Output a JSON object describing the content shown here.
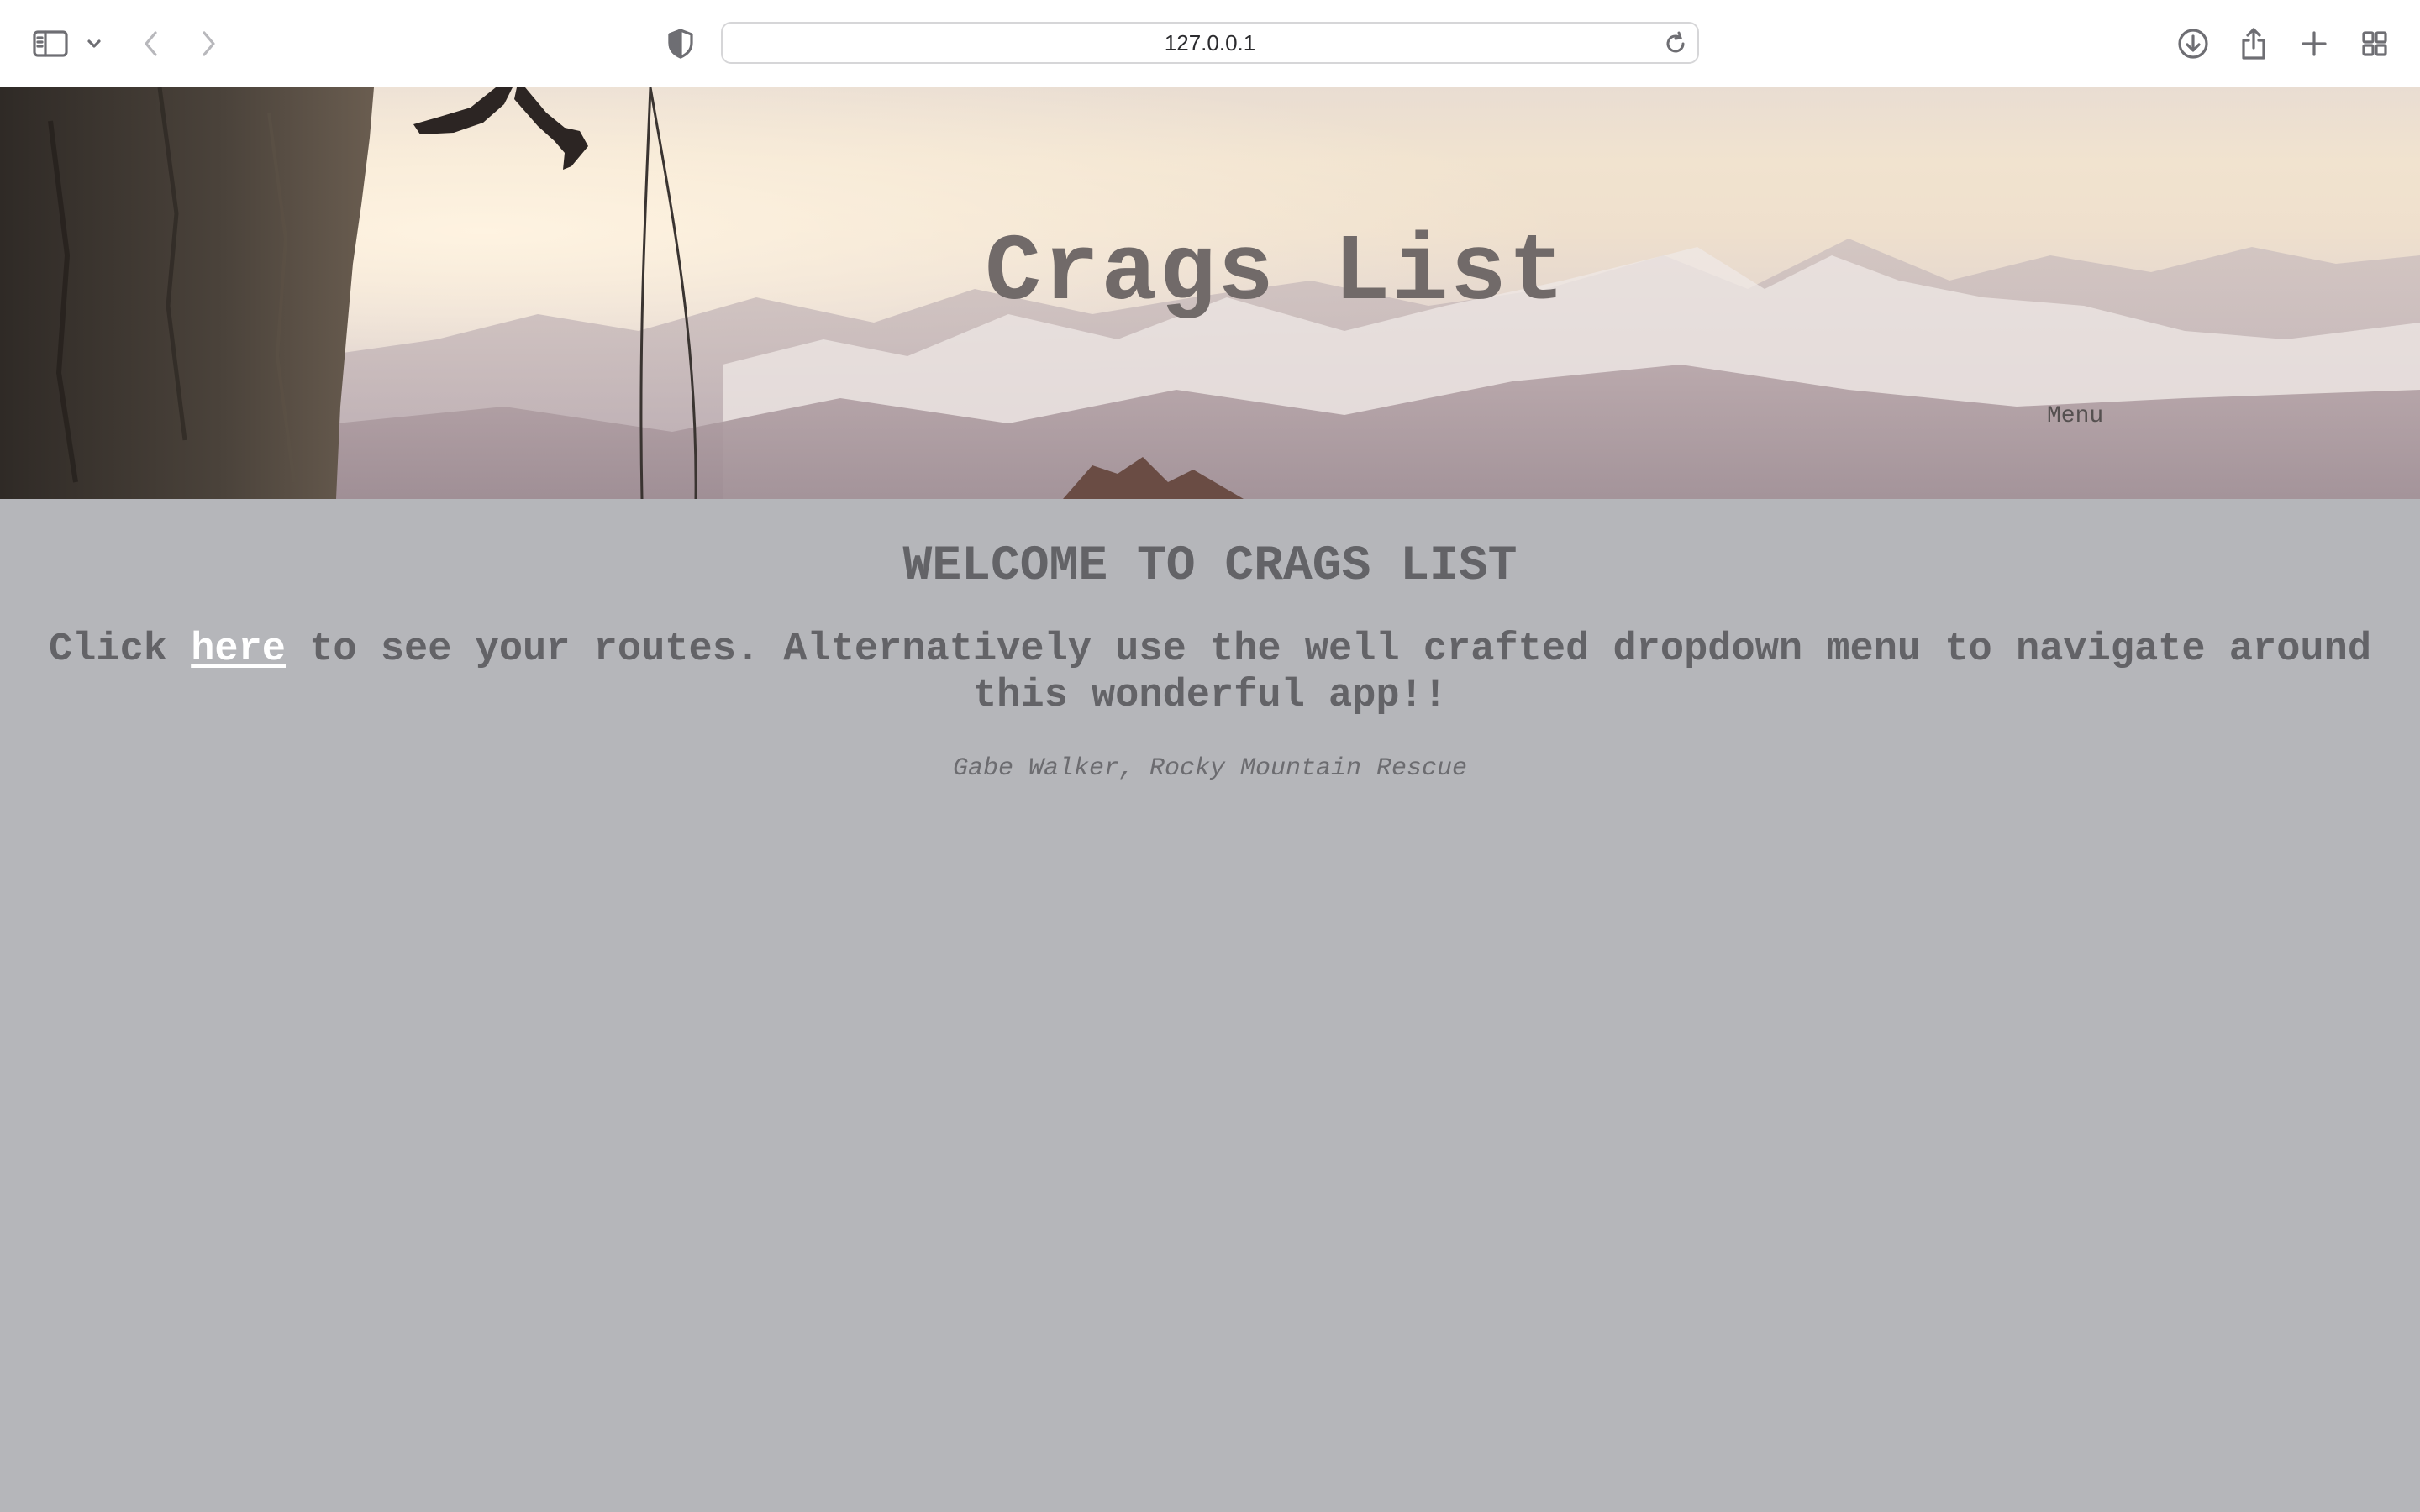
{
  "browser": {
    "url": "127.0.0.1",
    "icons": {
      "sidebar": "sidebar-icon",
      "sidebar_menu": "chevron-down-icon",
      "back": "chevron-left-icon",
      "forward": "chevron-right-icon",
      "privacy": "shield-icon",
      "reload": "reload-icon",
      "downloads": "download-icon",
      "share": "share-icon",
      "new_tab": "plus-icon",
      "tab_overview": "grid-icon"
    }
  },
  "header": {
    "title": "Crags List",
    "menu_label": "Menu"
  },
  "main": {
    "heading": "WELCOME TO CRAGS LIST",
    "intro_prefix": "Click ",
    "intro_link": "here",
    "intro_suffix": " to see your routes. Alternatively use the well crafted dropdown menu to navigate around this wonderful app!!",
    "quote": "Gabe Walker, Rocky Mountain Rescue"
  },
  "colors": {
    "page_background": "#b5b6ba",
    "text": "#636367",
    "title": "#716a69",
    "link": "#ffffff"
  }
}
